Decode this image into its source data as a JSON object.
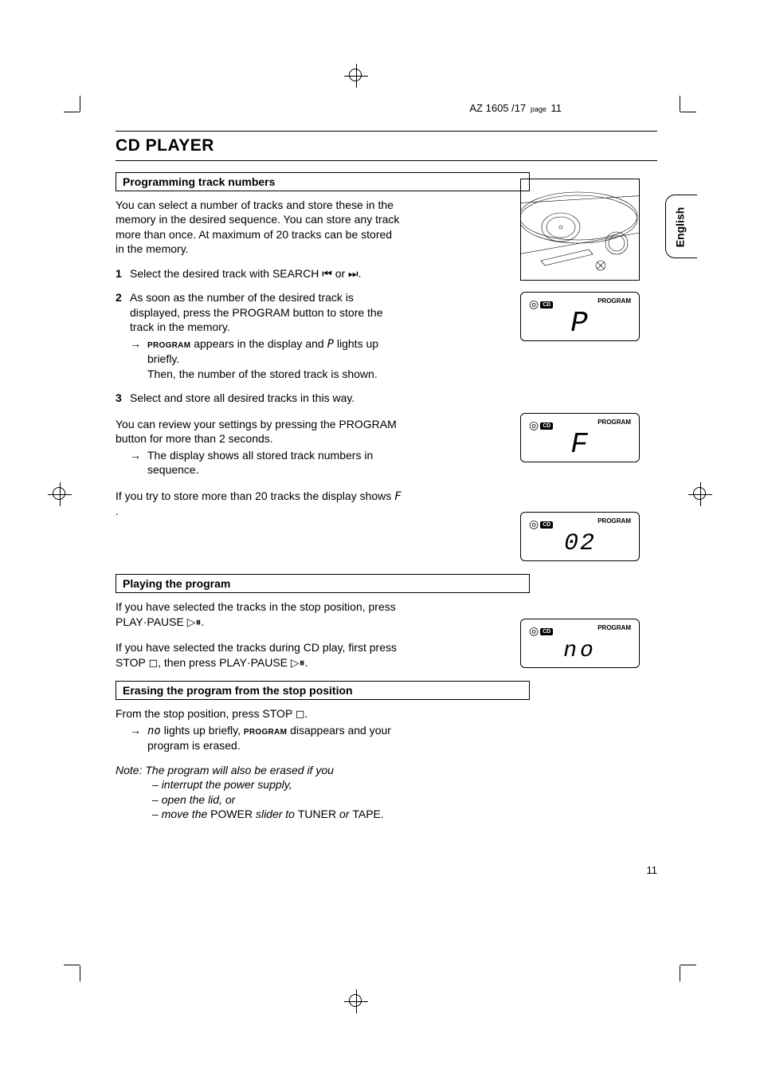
{
  "page_ref": {
    "model": "AZ 1605 /17",
    "page_label": "page",
    "page_num": "11"
  },
  "title": "CD PLAYER",
  "lang_tab": "English",
  "sections": {
    "programming": {
      "heading": "Programming track numbers",
      "intro": "You can select a number of tracks and store these in the memory in the desired sequence. You can store any track more than once. At maximum of 20 tracks can be stored in the memory.",
      "step1": {
        "num": "1",
        "text": "Select the desired track with SEARCH ⏮ or ⏭."
      },
      "step2": {
        "num": "2",
        "text": "As soon as the number of the desired track is displayed, press the PROGRAM button to store the track in the memory."
      },
      "step2_arrow": {
        "prog": "PROGRAM",
        "text_a": " appears in the display and ",
        "p_glyph": "P",
        "text_b": " lights up briefly."
      },
      "step2_then": "Then, the number of the stored track is shown.",
      "step3": {
        "num": "3",
        "text": "Select and store all desired tracks in this way."
      },
      "review": "You can review your settings by pressing the PROGRAM button for more than 2 seconds.",
      "review_arrow": "The display shows all stored track numbers in sequence.",
      "limit_a": "If you try to store more than 20 tracks the display shows ",
      "limit_glyph": "F",
      "limit_b": " ."
    },
    "playing": {
      "heading": "Playing the program",
      "p1": "If you have selected the tracks in the stop position, press PLAY·PAUSE ▷⏸.",
      "p2": "If you have selected the tracks during CD play, first press STOP ◻, then press PLAY·PAUSE ▷⏸."
    },
    "erasing": {
      "heading": "Erasing the program from the stop position",
      "intro": "From the stop position, press STOP ◻.",
      "arrow_a": "no",
      "arrow_b": " lights up briefly, ",
      "arrow_prog": "PROGRAM",
      "arrow_c": " disappears and your program is erased.",
      "note_title": "Note: The program will also be erased if you",
      "note1": "interrupt the power supply,",
      "note2": "open the lid, or",
      "note3_a": "move the ",
      "note3_b": "POWER",
      "note3_c": " slider to ",
      "note3_d": "TUNER",
      "note3_e": " or ",
      "note3_f": "TAPE."
    }
  },
  "displays": {
    "cd_label": "CD",
    "program_label": "PROGRAM",
    "box1_value": "P",
    "box2_value": "F",
    "box3_value": "02",
    "box4_value": "no"
  },
  "footer_page": "11"
}
